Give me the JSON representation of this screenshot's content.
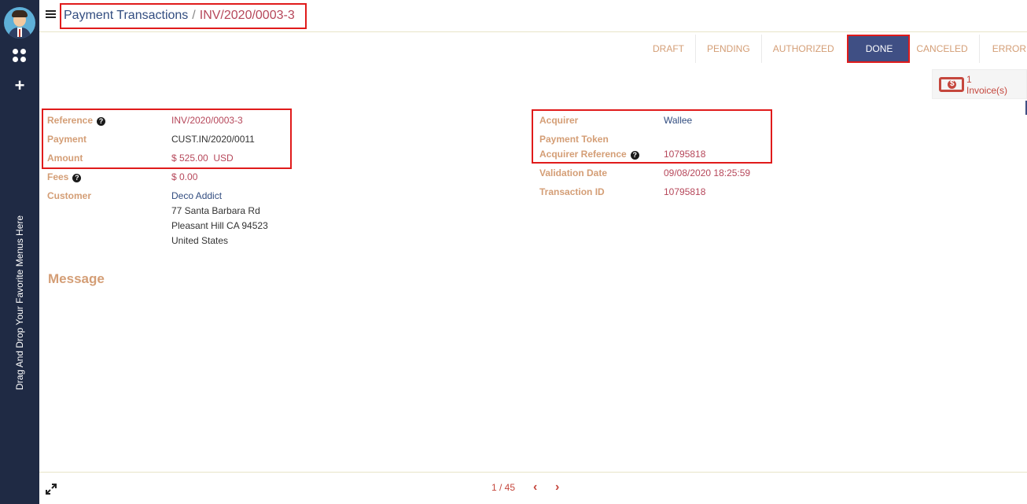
{
  "sidebar": {
    "favorites_hint": "Drag And Drop Your Favorite Menus Here"
  },
  "breadcrumb": {
    "parent": "Payment Transactions",
    "separator": "/",
    "current": "INV/2020/0003-3"
  },
  "statusbar": {
    "stages": [
      "DRAFT",
      "PENDING",
      "AUTHORIZED",
      "DONE",
      "CANCELED",
      "ERROR"
    ],
    "active": "DONE"
  },
  "smart_button": {
    "count": "1",
    "label": "Invoice(s)"
  },
  "form": {
    "reference": {
      "label": "Reference",
      "value": "INV/2020/0003-3"
    },
    "payment": {
      "label": "Payment",
      "value": "CUST.IN/2020/0011"
    },
    "amount": {
      "label": "Amount",
      "value": "$ 525.00  USD"
    },
    "fees": {
      "label": "Fees",
      "value": "$ 0.00"
    },
    "customer": {
      "label": "Customer",
      "name": "Deco Addict",
      "address_line1": "77 Santa Barbara Rd",
      "address_line2": "Pleasant Hill CA 94523",
      "country": "United States"
    },
    "acquirer": {
      "label": "Acquirer",
      "value": "Wallee"
    },
    "payment_token": {
      "label": "Payment Token",
      "value": ""
    },
    "acquirer_reference": {
      "label": "Acquirer Reference",
      "value": "10795818"
    },
    "validation_date": {
      "label": "Validation Date",
      "value": "09/08/2020 18:25:59"
    },
    "transaction_id": {
      "label": "Transaction ID",
      "value": "10795818"
    },
    "message_title": "Message"
  },
  "pager": {
    "text": "1 / 45"
  },
  "colors": {
    "sidebar_bg": "#1f2a44",
    "accent": "#3f4f84",
    "label": "#d49e76",
    "value_red": "#b6475a",
    "highlight": "#e01b1b"
  }
}
